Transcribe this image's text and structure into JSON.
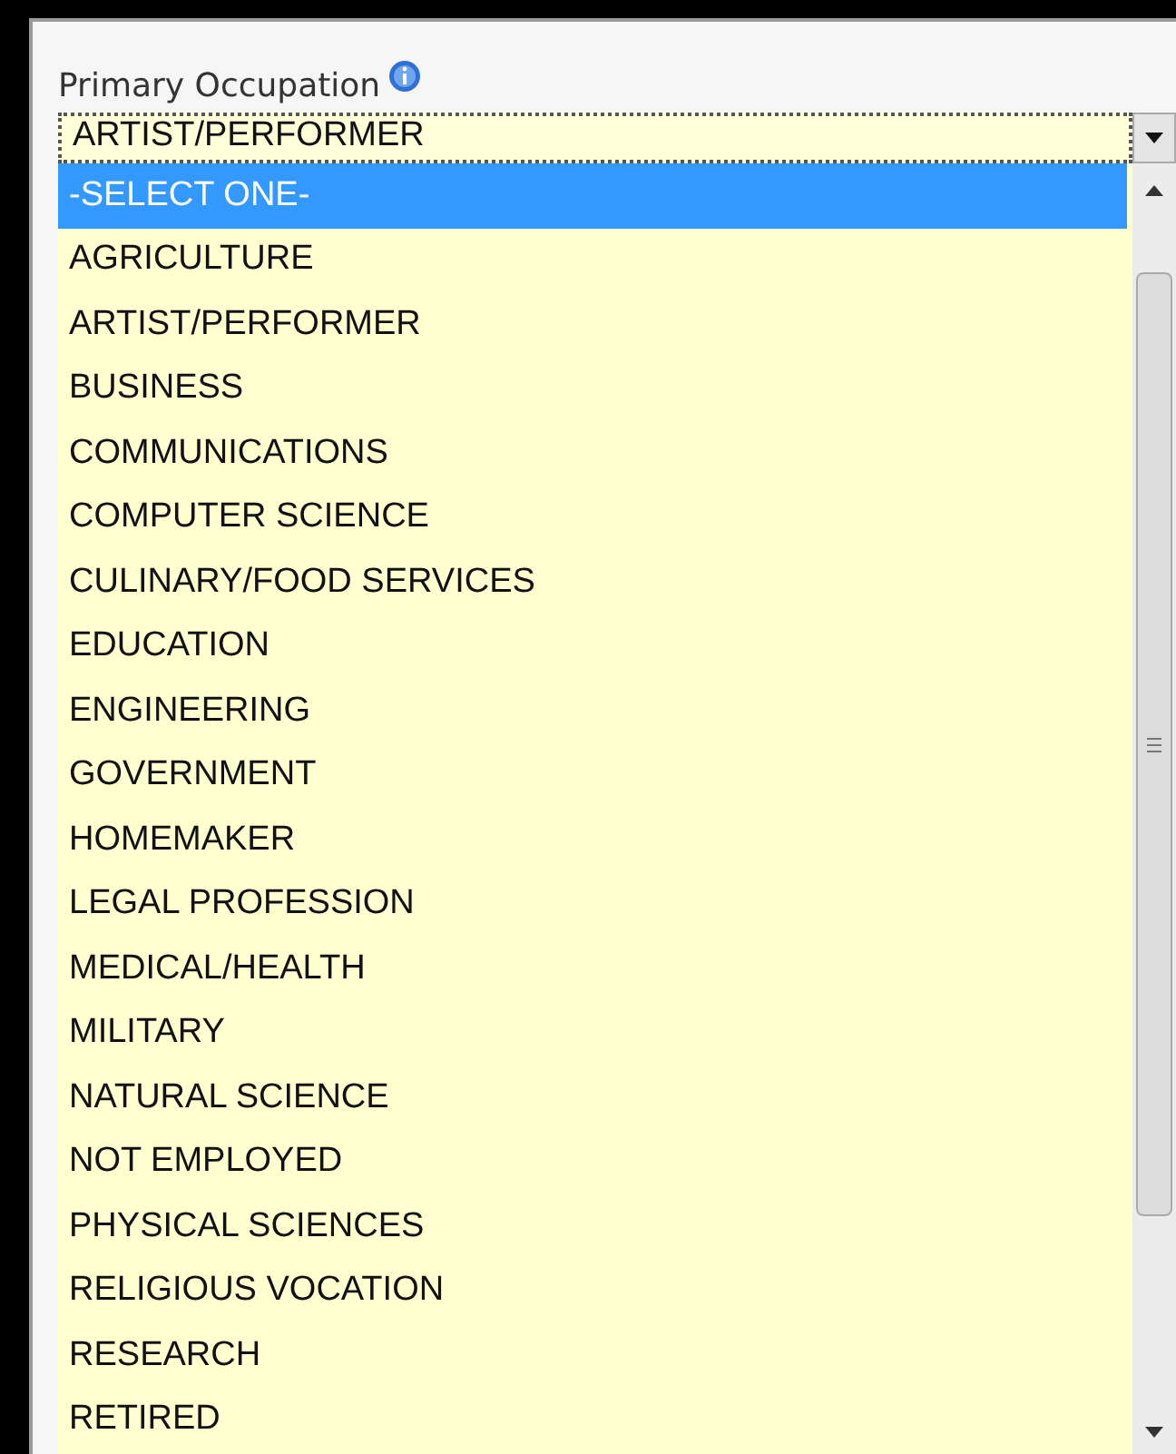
{
  "field": {
    "label": "Primary Occupation",
    "value": "ARTIST/PERFORMER"
  },
  "options": [
    {
      "label": "-SELECT ONE-",
      "selected": true
    },
    {
      "label": "AGRICULTURE",
      "selected": false
    },
    {
      "label": "ARTIST/PERFORMER",
      "selected": false
    },
    {
      "label": "BUSINESS",
      "selected": false
    },
    {
      "label": "COMMUNICATIONS",
      "selected": false
    },
    {
      "label": "COMPUTER SCIENCE",
      "selected": false
    },
    {
      "label": "CULINARY/FOOD SERVICES",
      "selected": false
    },
    {
      "label": "EDUCATION",
      "selected": false
    },
    {
      "label": "ENGINEERING",
      "selected": false
    },
    {
      "label": "GOVERNMENT",
      "selected": false
    },
    {
      "label": "HOMEMAKER",
      "selected": false
    },
    {
      "label": "LEGAL PROFESSION",
      "selected": false
    },
    {
      "label": "MEDICAL/HEALTH",
      "selected": false
    },
    {
      "label": "MILITARY",
      "selected": false
    },
    {
      "label": "NATURAL SCIENCE",
      "selected": false
    },
    {
      "label": "NOT EMPLOYED",
      "selected": false
    },
    {
      "label": "PHYSICAL SCIENCES",
      "selected": false
    },
    {
      "label": "RELIGIOUS VOCATION",
      "selected": false
    },
    {
      "label": "RESEARCH",
      "selected": false
    },
    {
      "label": "RETIRED",
      "selected": false
    }
  ]
}
